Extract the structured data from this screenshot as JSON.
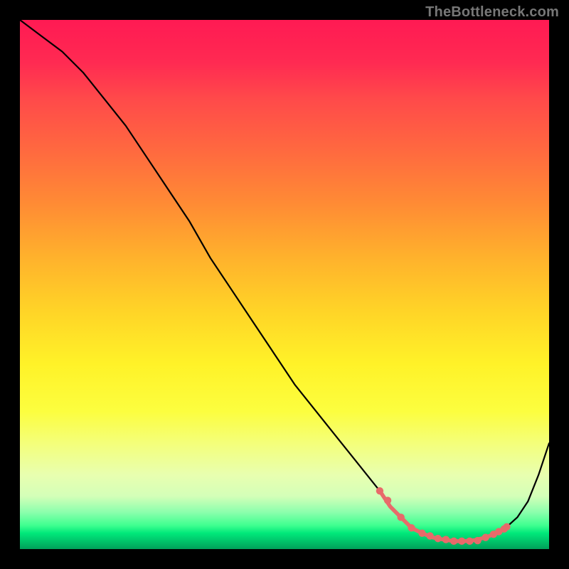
{
  "watermark": "TheBottleneck.com",
  "colors": {
    "marker": "#e86a6a",
    "curve": "#000000"
  },
  "chart_data": {
    "type": "line",
    "title": "",
    "xlabel": "",
    "ylabel": "",
    "xlim": [
      0,
      100
    ],
    "ylim": [
      0,
      100
    ],
    "grid": false,
    "legend": false,
    "series": [
      {
        "name": "bottleneck-curve",
        "x": [
          0,
          4,
          8,
          12,
          16,
          20,
          24,
          28,
          32,
          36,
          40,
          44,
          48,
          52,
          56,
          60,
          64,
          68,
          70,
          72,
          74,
          76,
          78,
          80,
          82,
          84,
          86,
          88,
          90,
          92,
          94,
          96,
          98,
          100
        ],
        "y": [
          100,
          97,
          94,
          90,
          85,
          80,
          74,
          68,
          62,
          55,
          49,
          43,
          37,
          31,
          26,
          21,
          16,
          11,
          8,
          6,
          4,
          3,
          2.2,
          1.8,
          1.5,
          1.5,
          1.7,
          2.2,
          3.0,
          4.2,
          6.0,
          9.0,
          14,
          20
        ]
      }
    ],
    "highlight_region": {
      "name": "optimal-range",
      "x": [
        68,
        70,
        72,
        74,
        76,
        78,
        80,
        82,
        84,
        86,
        88,
        90,
        92
      ],
      "y": [
        11,
        8,
        6,
        4,
        3,
        2.2,
        1.8,
        1.5,
        1.5,
        1.7,
        2.2,
        3.0,
        4.2
      ]
    },
    "markers": {
      "name": "marker-dots",
      "x": [
        68,
        69.5,
        72,
        74,
        76,
        77.5,
        79,
        80.5,
        82,
        83.5,
        85,
        86.5,
        88,
        89.5,
        90.5,
        91.5,
        92
      ],
      "y": [
        11,
        9.2,
        6,
        4,
        3,
        2.5,
        2.0,
        1.8,
        1.5,
        1.5,
        1.5,
        1.6,
        2.2,
        2.8,
        3.3,
        3.8,
        4.2
      ]
    }
  }
}
